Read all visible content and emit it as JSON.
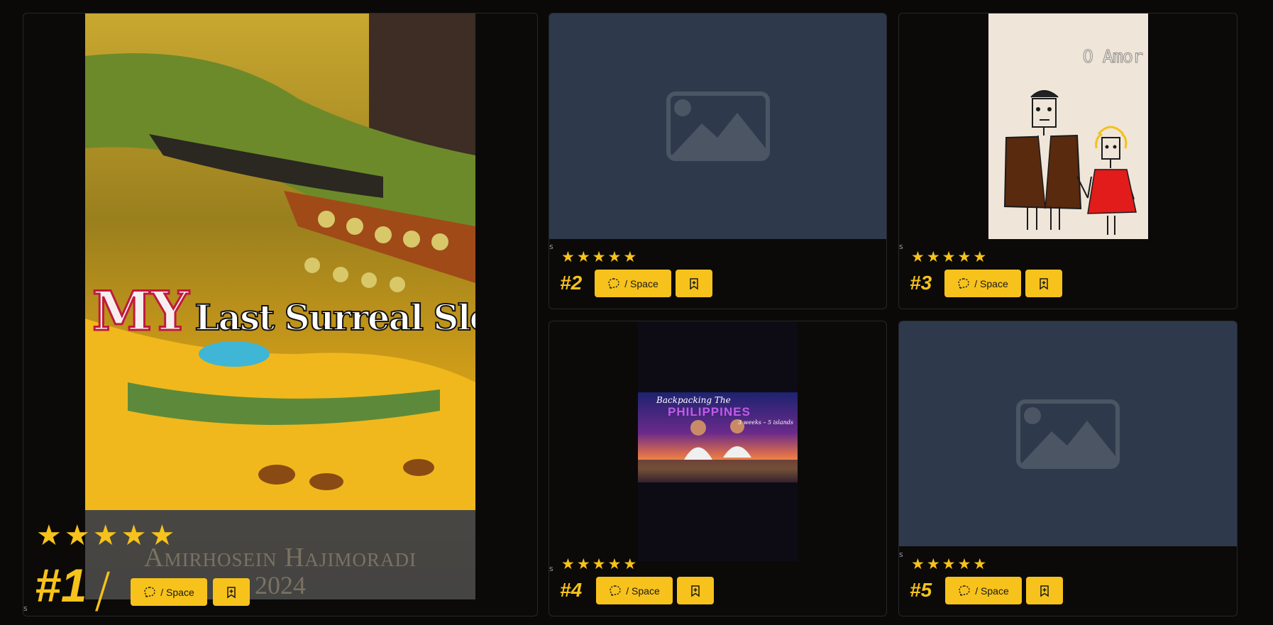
{
  "colors": {
    "accent": "#f7c21b",
    "placeholder": "#2e3a4c",
    "background": "#0a0908"
  },
  "cards": [
    {
      "rank": "#1",
      "stars": [
        "★",
        "★",
        "★",
        "★",
        "★"
      ],
      "space_label": "/ Space",
      "tag": "s",
      "poster": {
        "title_word_1": "MY",
        "title_rest": "Last Surreal Sleep",
        "author": "Amirhosein Hajimoradi",
        "year": "2024"
      },
      "slash": "/",
      "icons": {
        "space": "chat-bubble-dashed-icon",
        "save": "bookmark-plus-icon"
      }
    },
    {
      "rank": "#2",
      "stars": [
        "★",
        "★",
        "★",
        "★",
        "★"
      ],
      "space_label": "/ Space",
      "tag": "s",
      "poster": null,
      "icons": {
        "image": "image-placeholder-icon",
        "space": "chat-bubble-dashed-icon",
        "save": "bookmark-plus-icon"
      }
    },
    {
      "rank": "#3",
      "stars": [
        "★",
        "★",
        "★",
        "★",
        "★"
      ],
      "space_label": "/ Space",
      "tag": "s",
      "poster": {
        "title": "O Amor"
      },
      "icons": {
        "space": "chat-bubble-dashed-icon",
        "save": "bookmark-plus-icon"
      }
    },
    {
      "rank": "#4",
      "stars": [
        "★",
        "★",
        "★",
        "★",
        "★"
      ],
      "space_label": "/ Space",
      "tag": "s",
      "poster": {
        "line_1": "Backpacking The",
        "line_2": "PHILIPPINES",
        "line_3": "3 weeks – 5 islands"
      },
      "icons": {
        "space": "chat-bubble-dashed-icon",
        "save": "bookmark-plus-icon"
      }
    },
    {
      "rank": "#5",
      "stars": [
        "★",
        "★",
        "★",
        "★",
        "★"
      ],
      "space_label": "/ Space",
      "tag": "s",
      "poster": null,
      "icons": {
        "image": "image-placeholder-icon",
        "space": "chat-bubble-dashed-icon",
        "save": "bookmark-plus-icon"
      }
    }
  ]
}
